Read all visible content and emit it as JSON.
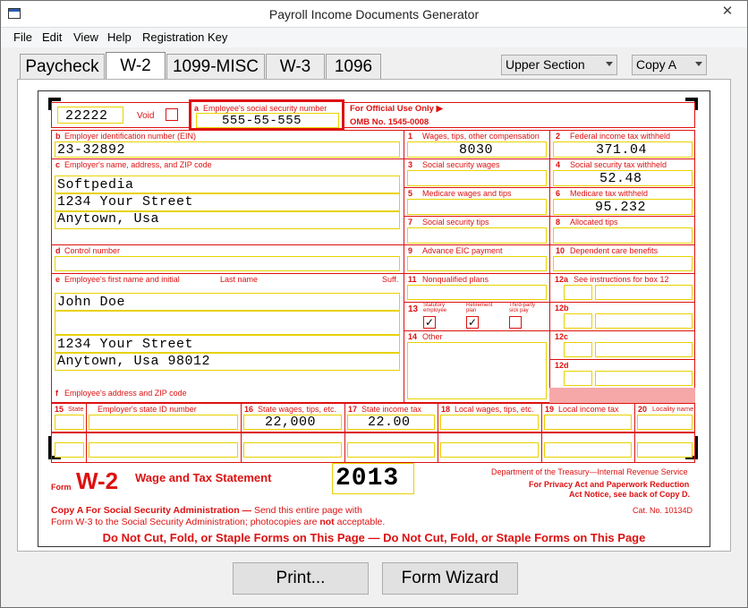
{
  "window": {
    "title": "Payroll Income Documents Generator",
    "close_symbol": "✕"
  },
  "menu": [
    "File",
    "Edit",
    "View",
    "Help",
    "Registration Key"
  ],
  "tabs": [
    "Paycheck",
    "W-2",
    "1099-MISC",
    "W-3",
    "1096"
  ],
  "section_dropdown": "Upper Section",
  "copy_dropdown": "Copy A",
  "form": {
    "code": "22222",
    "void_label": "Void",
    "ssn_label_letter": "a",
    "ssn_label": "Employee's social security number",
    "ssn": "555-55-555",
    "official_use": "For Official Use Only ▶",
    "omb": "OMB No. 1545-0008",
    "b_letter": "b",
    "b_label": "Employer identification number (EIN)",
    "ein": "23-32892",
    "c_letter": "c",
    "c_label": "Employer's name, address, and ZIP code",
    "employer_name": "Softpedia",
    "employer_street": "1234 Your Street",
    "employer_city": "Anytown, Usa",
    "d_letter": "d",
    "d_label": "Control number",
    "e_letter": "e",
    "e_label": "Employee's first name and initial",
    "e_last": "Last name",
    "e_suff": "Suff.",
    "employee_name": "John Doe",
    "employee_street": "1234 Your Street",
    "employee_city": "Anytown, Usa 98012",
    "f_letter": "f",
    "f_label": "Employee's address and ZIP code",
    "box1_num": "1",
    "box1_label": "Wages, tips, other compensation",
    "box1": "8030",
    "box2_num": "2",
    "box2_label": "Federal income tax withheld",
    "box2": "371.04",
    "box3_num": "3",
    "box3_label": "Social security wages",
    "box4_num": "4",
    "box4_label": "Social security tax withheld",
    "box4": "52.48",
    "box5_num": "5",
    "box5_label": "Medicare wages and tips",
    "box6_num": "6",
    "box6_label": "Medicare tax withheld",
    "box6": "95.232",
    "box7_num": "7",
    "box7_label": "Social security tips",
    "box8_num": "8",
    "box8_label": "Allocated tips",
    "box9_num": "9",
    "box9_label": "Advance EIC payment",
    "box10_num": "10",
    "box10_label": "Dependent care benefits",
    "box11_num": "11",
    "box11_label": "Nonqualified plans",
    "box12a_num": "12a",
    "box12a_label": "See instructions for box 12",
    "box12b": "12b",
    "box12c": "12c",
    "box12d": "12d",
    "box13_num": "13",
    "statutory_label": "Statutory employee",
    "retirement_label": "Retirement plan",
    "thirdparty_label": "Third-party sick pay",
    "statutory_checked": "✓",
    "retirement_checked": "✓",
    "box14_num": "14",
    "box14_label": "Other",
    "box15_num": "15",
    "box15_label": "State",
    "employer_state_id_label": "Employer's state ID number",
    "box16_num": "16",
    "box16_label": "State wages, tips, etc.",
    "box16": "22,000",
    "box17_num": "17",
    "box17_label": "State income tax",
    "box17": "22.00",
    "box18_num": "18",
    "box18_label": "Local wages, tips, etc.",
    "box19_num": "19",
    "box19_label": "Local income tax",
    "box20_num": "20",
    "box20_label": "Locality name",
    "form_word": "Form",
    "form_name": "W-2",
    "form_title": "Wage and Tax Statement",
    "year": "2013",
    "dept": "Department of the Treasury—Internal Revenue Service",
    "privacy1": "For Privacy Act and Paperwork Reduction",
    "privacy2": "Act Notice, see back of Copy D.",
    "catno": "Cat. No. 10134D",
    "copy_a_bold": "Copy A For Social Security Administration —",
    "copy_a_text": " Send this entire page with",
    "copy_a_line2a": "Form W-3 to the Social Security Administration; photocopies are ",
    "copy_a_not": "not",
    "copy_a_line2b": " acceptable.",
    "do_not_cut": "Do Not Cut, Fold, or Staple Forms on This Page — Do Not Cut, Fold, or Staple Forms on This Page"
  },
  "buttons": {
    "print": "Print...",
    "wizard": "Form Wizard"
  }
}
